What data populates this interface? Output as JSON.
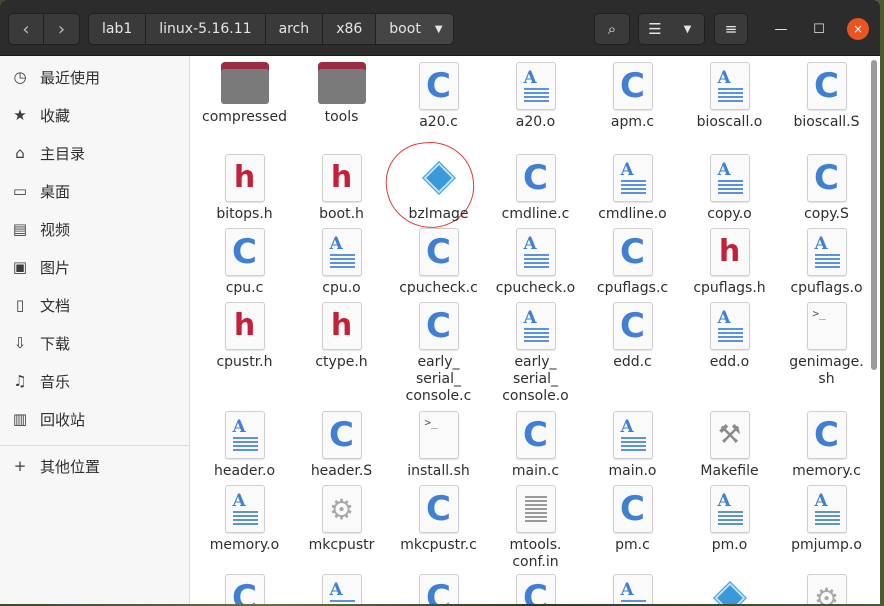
{
  "breadcrumbs": [
    "lab1",
    "linux-5.16.11",
    "arch",
    "x86",
    "boot"
  ],
  "window_controls": {
    "minimize": "—",
    "maximize": "☐",
    "close": "×"
  },
  "sidebar": [
    {
      "icon": "clock-icon",
      "glyph": "◷",
      "label": "最近使用"
    },
    {
      "icon": "star-icon",
      "glyph": "★",
      "label": "收藏"
    },
    {
      "icon": "home-icon",
      "glyph": "⌂",
      "label": "主目录"
    },
    {
      "icon": "desktop-icon",
      "glyph": "▭",
      "label": "桌面"
    },
    {
      "icon": "video-icon",
      "glyph": "▤",
      "label": "视频"
    },
    {
      "icon": "picture-icon",
      "glyph": "▣",
      "label": "图片"
    },
    {
      "icon": "document-icon",
      "glyph": "▯",
      "label": "文档"
    },
    {
      "icon": "download-icon",
      "glyph": "⇩",
      "label": "下载"
    },
    {
      "icon": "music-icon",
      "glyph": "♫",
      "label": "音乐"
    },
    {
      "icon": "trash-icon",
      "glyph": "▥",
      "label": "回收站"
    },
    {
      "icon": "plus-icon",
      "glyph": "+",
      "label": "其他位置"
    }
  ],
  "files": [
    {
      "name": "compressed",
      "type": "folder"
    },
    {
      "name": "tools",
      "type": "folder"
    },
    {
      "name": "a20.c",
      "type": "c"
    },
    {
      "name": "a20.o",
      "type": "o"
    },
    {
      "name": "apm.c",
      "type": "c"
    },
    {
      "name": "bioscall.o",
      "type": "o"
    },
    {
      "name": "bioscall.S",
      "type": "c"
    },
    {
      "name": "bitops.h",
      "type": "h"
    },
    {
      "name": "boot.h",
      "type": "h"
    },
    {
      "name": "bzImage",
      "type": "bz"
    },
    {
      "name": "cmdline.c",
      "type": "c"
    },
    {
      "name": "cmdline.o",
      "type": "o"
    },
    {
      "name": "copy.o",
      "type": "o"
    },
    {
      "name": "copy.S",
      "type": "c"
    },
    {
      "name": "cpu.c",
      "type": "c"
    },
    {
      "name": "cpu.o",
      "type": "o"
    },
    {
      "name": "cpucheck.c",
      "type": "c"
    },
    {
      "name": "cpucheck.o",
      "type": "o"
    },
    {
      "name": "cpuflags.c",
      "type": "c"
    },
    {
      "name": "cpuflags.h",
      "type": "h"
    },
    {
      "name": "cpuflags.o",
      "type": "o"
    },
    {
      "name": "cpustr.h",
      "type": "h"
    },
    {
      "name": "ctype.h",
      "type": "h"
    },
    {
      "name": "early_\nserial_\nconsole.c",
      "type": "c"
    },
    {
      "name": "early_\nserial_\nconsole.o",
      "type": "o"
    },
    {
      "name": "edd.c",
      "type": "c"
    },
    {
      "name": "edd.o",
      "type": "o"
    },
    {
      "name": "genimage.\nsh",
      "type": "sh"
    },
    {
      "name": "header.o",
      "type": "o"
    },
    {
      "name": "header.S",
      "type": "c"
    },
    {
      "name": "install.sh",
      "type": "sh"
    },
    {
      "name": "main.c",
      "type": "c"
    },
    {
      "name": "main.o",
      "type": "o"
    },
    {
      "name": "Makefile",
      "type": "make"
    },
    {
      "name": "memory.c",
      "type": "c"
    },
    {
      "name": "memory.o",
      "type": "o"
    },
    {
      "name": "mkcpustr",
      "type": "gear"
    },
    {
      "name": "mkcpustr.c",
      "type": "c"
    },
    {
      "name": "mtools.\nconf.in",
      "type": "txt"
    },
    {
      "name": "pm.c",
      "type": "c"
    },
    {
      "name": "pm.o",
      "type": "o"
    },
    {
      "name": "pmjump.o",
      "type": "o"
    },
    {
      "name": "",
      "type": "c"
    },
    {
      "name": "",
      "type": "o"
    },
    {
      "name": "",
      "type": "c"
    },
    {
      "name": "",
      "type": "c"
    },
    {
      "name": "",
      "type": "o"
    },
    {
      "name": "",
      "type": "bz"
    },
    {
      "name": "",
      "type": "gear"
    }
  ]
}
